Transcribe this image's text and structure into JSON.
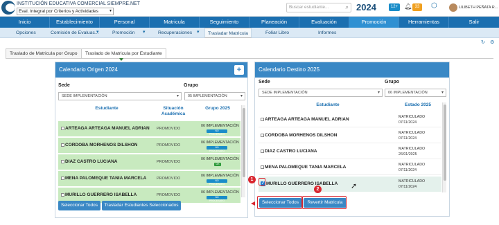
{
  "header": {
    "school": "INSTITUCIÓN EDUCATIVA COMERCIAL SIEMPRE.NET",
    "eval_select": "Eval. Integral por Criterios y Actividades",
    "search_placeholder": "Buscar estudiante...",
    "year": "2024",
    "badge_blue": "12+",
    "badge_orange": "33",
    "user": "LILIBETH PEÑATA R..."
  },
  "nav": [
    "Inicio",
    "Establecimiento",
    "Personal",
    "Matricula",
    "Seguimiento",
    "Planeación",
    "Evaluación",
    "Promoción",
    "Herramientas",
    "Salir"
  ],
  "subnav": {
    "opciones": "Opciones",
    "comision": "Comisión de Evaluac...",
    "promocion": "Promoción",
    "recuperaciones": "Recuperaciones",
    "trasladar": "Trasladar Matricula",
    "folio": "Foliar Libro",
    "informes": "Informes"
  },
  "tabs": {
    "grupo": "Traslado de Matricula por Grupo",
    "estudiante": "Traslado de Matricula por Estudiante"
  },
  "origen": {
    "title": "Calendario Origen 2024",
    "plus": "+",
    "sede_label": "Sede",
    "grupo_label": "Grupo",
    "sede_value": "SEDE IMPLEMENTACIÓN",
    "grupo_value": "05 IMPLEMENTACIÓN",
    "col_estudiante": "Estudiante",
    "col_situacion": "Situación Académica",
    "col_grupo": "Grupo 2025",
    "rows": [
      {
        "name": "ARTEAGA ARTEAGA MANUEL ADRIAN",
        "situacion": "PROMOVIDO",
        "grupo": "06 IMPLEMENTACIÓN",
        "badge": "NO PROCESADO"
      },
      {
        "name": "CORDOBA MORHENOS DILSHON",
        "situacion": "PROMOVIDO",
        "grupo": "06 IMPLEMENTACIÓN",
        "badge": "NO PROCESADO"
      },
      {
        "name": "DIAZ CASTRO LUCIANA",
        "situacion": "PROMOVIDO",
        "grupo": "06 IMPLEMENTACIÓN",
        "badge": "OK"
      },
      {
        "name": "MENA PALOMEQUE TANIA MARCELA",
        "situacion": "PROMOVIDO",
        "grupo": "06 IMPLEMENTACIÓN",
        "badge": "NO PROCESADO"
      },
      {
        "name": "MURILLO GUERRERO ISABELLA",
        "situacion": "PROMOVIDO",
        "grupo": "06 IMPLEMENTACIÓN",
        "badge": "NO PROCESADO"
      }
    ],
    "btn_select": "Seleccionar Todos",
    "btn_trasladar": "Trasladar Estudiantes Seleccionados"
  },
  "destino": {
    "title": "Calendario Destino 2025",
    "sede_label": "Sede",
    "grupo_label": "Grupo",
    "sede_value": "SEDE IMPLEMENTACIÓN",
    "grupo_value": "06 IMPLEMENTACIÓN",
    "col_estudiante": "Estudiante",
    "col_estado": "Estado 2025",
    "rows": [
      {
        "name": "ARTEAGA ARTEAGA MANUEL ADRIAN",
        "estado": "MATRICULADO",
        "fecha": "07/11/2024"
      },
      {
        "name": "CORDOBA MORHENOS DILSHON",
        "estado": "MATRICULADO",
        "fecha": "07/11/2024"
      },
      {
        "name": "DIAZ CASTRO LUCIANA",
        "estado": "MATRICULADO",
        "fecha": "26/01/2025"
      },
      {
        "name": "MENA PALOMEQUE TANIA MARCELA",
        "estado": "MATRICULADO",
        "fecha": "07/11/2024"
      },
      {
        "name": "MURILLO GUERRERO ISABELLA",
        "estado": "MATRICULADO",
        "fecha": "07/11/2024"
      }
    ],
    "btn_select": "Seleccionar Todos",
    "btn_revertir": "Revertir Matricula"
  },
  "annotations": {
    "one": "1",
    "two": "2"
  },
  "colors": {
    "nav": "#1b6fb0",
    "active": "#2f90d2",
    "row_green": "#c8eabf",
    "highlight": "#d9262f"
  }
}
